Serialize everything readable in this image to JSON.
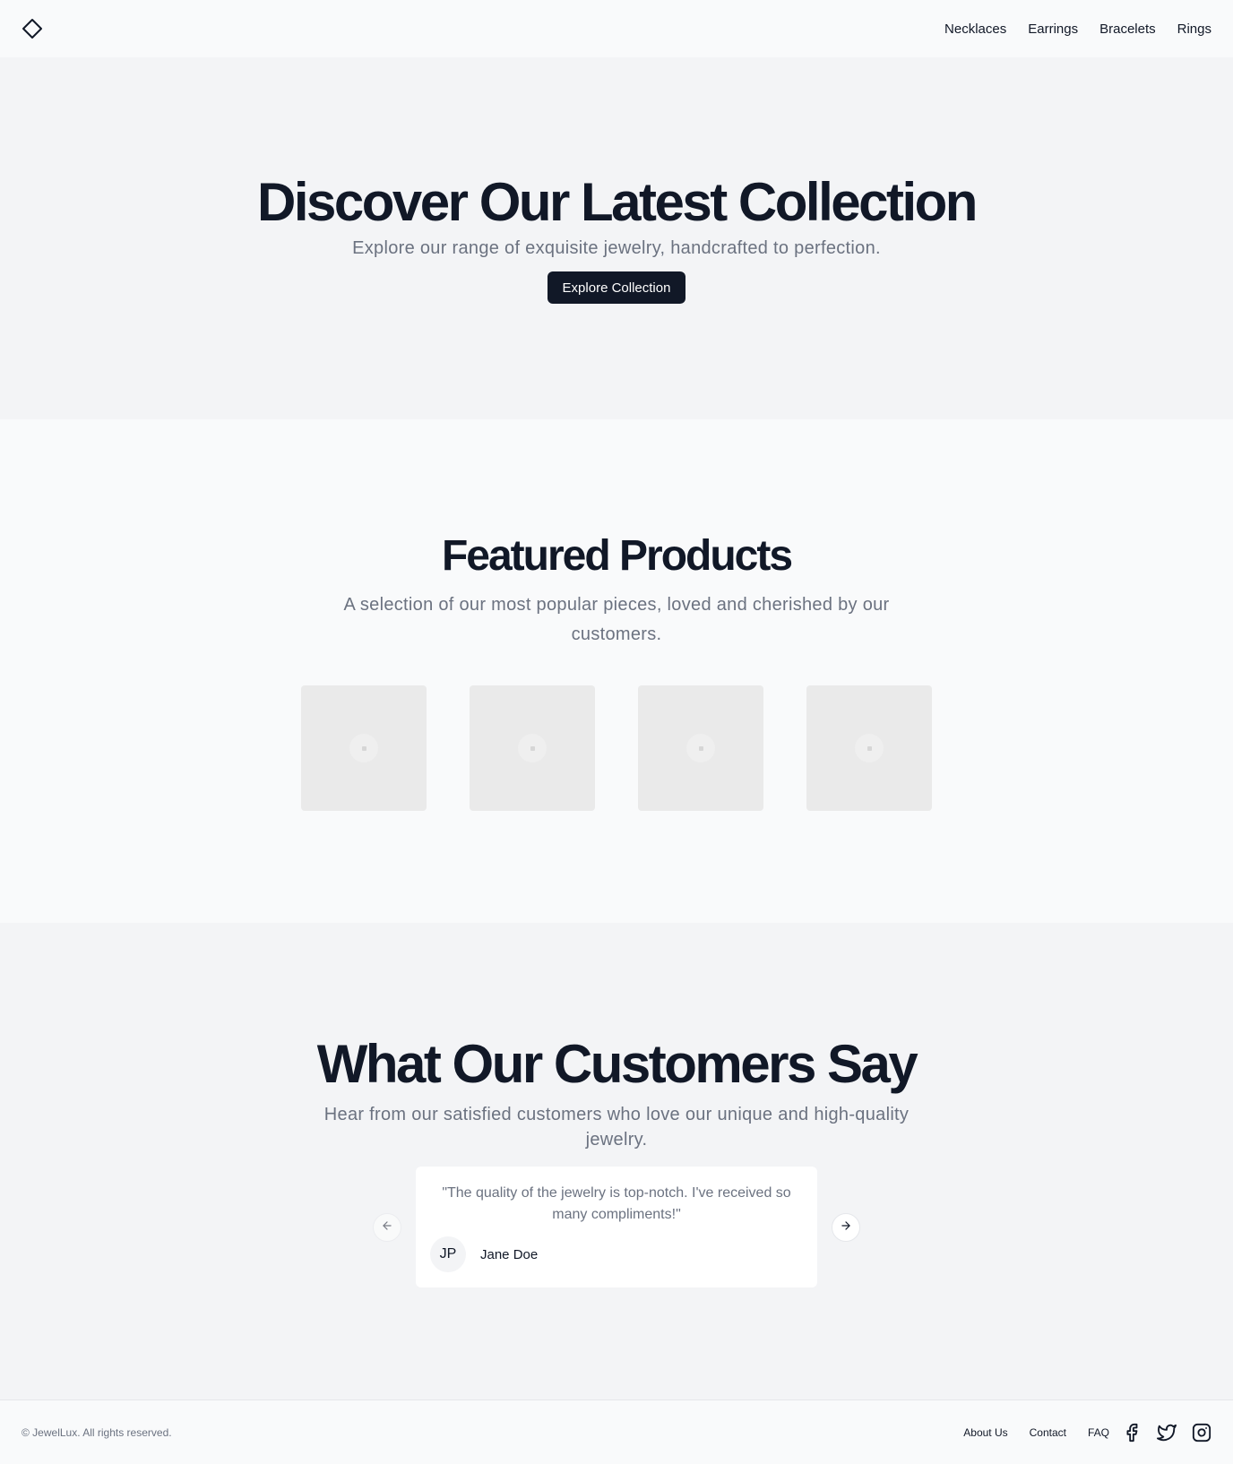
{
  "header": {
    "logo_icon": "diamond-icon",
    "nav": [
      "Necklaces",
      "Earrings",
      "Bracelets",
      "Rings"
    ]
  },
  "hero": {
    "title": "Discover Our Latest Collection",
    "subtitle": "Explore our range of exquisite jewelry, handcrafted to perfection.",
    "button_label": "Explore Collection"
  },
  "featured": {
    "title": "Featured Products",
    "subtitle": "A selection of our most popular pieces, loved and cherished by our customers.",
    "product_count": 4
  },
  "testimonials": {
    "title": "What Our Customers Say",
    "subtitle": "Hear from our satisfied customers who love our unique and high-quality jewelry.",
    "quote": "\"The quality of the jewelry is top-notch. I've received so many compliments!\"",
    "avatar_initials": "JP",
    "author": "Jane Doe",
    "prev_icon": "arrow-left-icon",
    "next_icon": "arrow-right-icon"
  },
  "footer": {
    "copyright": "© JewelLux. All rights reserved.",
    "links": [
      "About Us",
      "Contact",
      "FAQ"
    ],
    "social_icons": [
      "facebook-icon",
      "twitter-icon",
      "instagram-icon"
    ]
  },
  "colors": {
    "primary": "#111827",
    "muted_text": "#6b7280",
    "hero_bg": "#f3f4f6",
    "page_bg": "#f9fafb"
  }
}
